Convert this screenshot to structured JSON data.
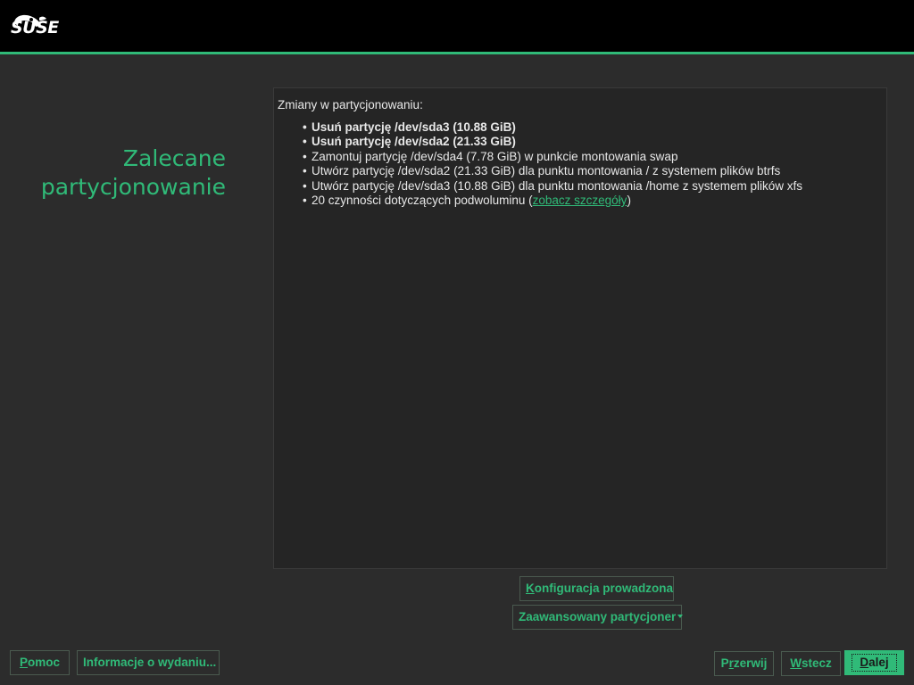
{
  "header": {
    "logo_text": "SUSE",
    "accent_color": "#30ba78",
    "logo_icon": "suse-chameleon-icon"
  },
  "page": {
    "title_line1": "Zalecane",
    "title_line2": "partycjonowanie"
  },
  "summary": {
    "heading": "Zmiany w partycjonowaniu:",
    "items": [
      {
        "text": "Usuń partycję /dev/sda3 (10.88 GiB)",
        "bold": true
      },
      {
        "text": "Usuń partycję /dev/sda2 (21.33 GiB)",
        "bold": true
      },
      {
        "text": "Zamontuj partycję /dev/sda4 (7.78 GiB) w punkcie montowania swap",
        "bold": false
      },
      {
        "text": "Utwórz partycję /dev/sda2 (21.33 GiB) dla punktu montowania / z systemem plików btrfs",
        "bold": false
      },
      {
        "text": "Utwórz partycję /dev/sda3 (10.88 GiB) dla punktu montowania /home z systemem plików xfs",
        "bold": false
      }
    ],
    "subvolume_item_prefix": "20 czynności dotyczących podwoluminu (",
    "subvolume_link": "zobacz szczegóły",
    "subvolume_item_suffix": ")"
  },
  "actions": {
    "guided_setup_u": "K",
    "guided_setup_rest": "onfiguracja prowadzona",
    "expert_partitioner": "Zaawansowany partycjoner"
  },
  "footer": {
    "help_u": "P",
    "help_rest": "omoc",
    "release_notes": "Informacje o wydaniu...",
    "abort_pre": "P",
    "abort_u": "r",
    "abort_rest": "zerwij",
    "back_u": "W",
    "back_rest": "stecz",
    "next_u": "D",
    "next_rest": "alej"
  }
}
